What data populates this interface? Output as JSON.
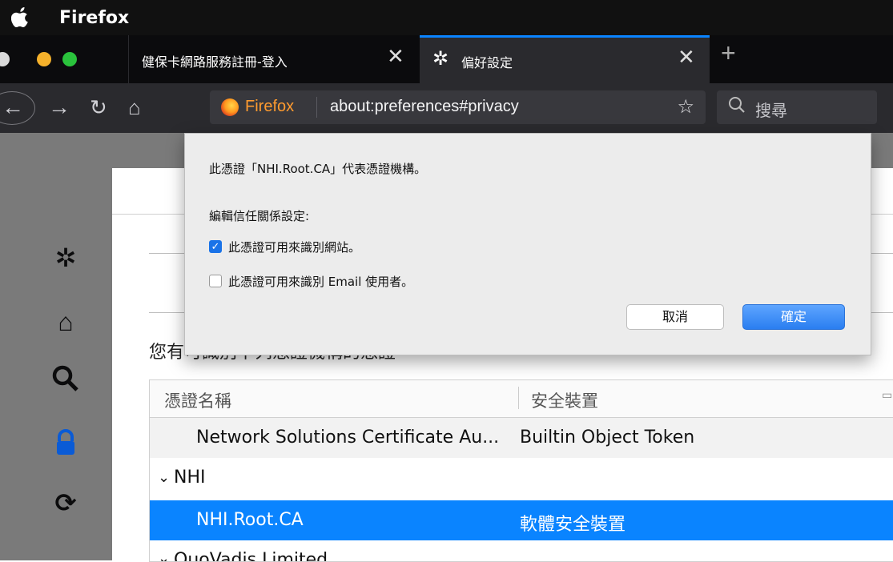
{
  "menubar": {
    "app_name": "Firefox"
  },
  "tabs": [
    {
      "label": "健保卡網路服務註冊-登入"
    },
    {
      "label": "偏好設定"
    }
  ],
  "navbar": {
    "identity_label": "Firefox",
    "url": "about:preferences#privacy",
    "search_placeholder": "搜尋"
  },
  "dialog": {
    "message": "此憑證「NHI.Root.CA」代表憑證機構。",
    "trust_heading": "編輯信任關係設定:",
    "options": [
      {
        "label": "此憑證可用來識別網站。",
        "checked": true
      },
      {
        "label": "此憑證可用來識別 Email 使用者。",
        "checked": false
      }
    ],
    "cancel_label": "取消",
    "ok_label": "確定"
  },
  "page": {
    "section_title": "您有可識別下列憑證機構的憑證"
  },
  "cert_table": {
    "columns": [
      "憑證名稱",
      "安全裝置"
    ],
    "rows": [
      {
        "name": "Network Solutions Certificate Au...",
        "device": "Builtin Object Token",
        "kind": "cert",
        "selected": false
      },
      {
        "name": "NHI",
        "device": "",
        "kind": "group",
        "selected": false
      },
      {
        "name": "NHI.Root.CA",
        "device": "軟體安全裝置",
        "kind": "cert",
        "selected": true
      },
      {
        "name": "QuoVadis Limited",
        "device": "",
        "kind": "group",
        "selected": false
      }
    ]
  },
  "colors": {
    "accent": "#0a84ff",
    "selected_row": "#0a84ff",
    "toolbar": "#2a2a2e"
  }
}
